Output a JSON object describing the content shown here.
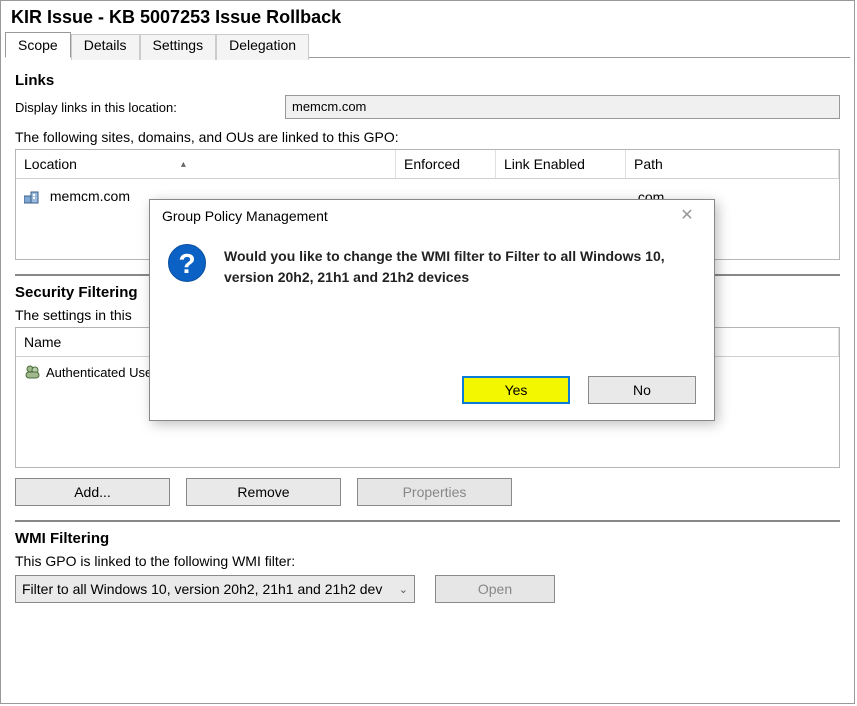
{
  "title": "KIR Issue - KB 5007253 Issue Rollback",
  "tabs": [
    "Scope",
    "Details",
    "Settings",
    "Delegation"
  ],
  "links": {
    "heading": "Links",
    "display_label": "Display links in this location:",
    "display_value": "memcm.com",
    "subtext": "The following sites, domains, and OUs are linked to this GPO:",
    "cols": {
      "location": "Location",
      "enforced": "Enforced",
      "link_enabled": "Link Enabled",
      "path": "Path"
    },
    "rows": [
      {
        "location": "memcm.com",
        "path_suffix": ".com"
      }
    ]
  },
  "sec": {
    "heading": "Security Filtering",
    "subtext": "The settings in this",
    "col_name": "Name",
    "rows": [
      {
        "name": "Authenticated Users"
      }
    ],
    "add": "Add...",
    "remove": "Remove",
    "props": "Properties"
  },
  "wmi": {
    "heading": "WMI Filtering",
    "subtext": "This GPO is linked to the following WMI filter:",
    "selected": "Filter to all Windows 10, version 20h2, 21h1 and 21h2 dev",
    "open": "Open"
  },
  "dialog": {
    "title": "Group Policy Management",
    "message": "Would you like to change the WMI filter to Filter to all Windows 10, version 20h2, 21h1 and 21h2 devices",
    "yes": "Yes",
    "no": "No"
  }
}
